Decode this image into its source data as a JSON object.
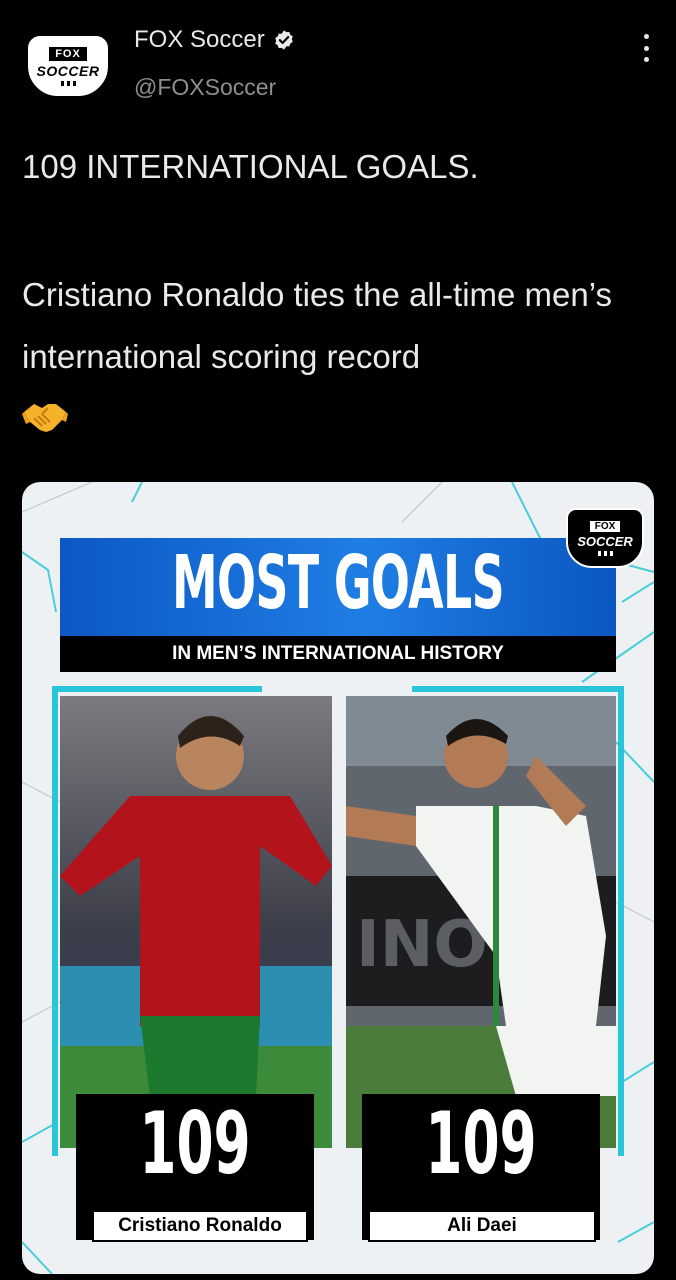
{
  "account": {
    "name": "FOX Soccer",
    "handle": "@FOXSoccer",
    "logo_top": "FOX",
    "logo_bottom": "SOCCER"
  },
  "tweet": {
    "line1": "109 INTERNATIONAL GOALS.",
    "line2": "Cristiano Ronaldo ties the all-time men’s international scoring record",
    "emoji": "handshake-emoji"
  },
  "graphic": {
    "title": "MOST GOALS",
    "subtitle": "IN MEN’S INTERNATIONAL HISTORY",
    "logo_top": "FOX",
    "logo_bottom": "SOCCER",
    "players": [
      {
        "name": "Cristiano Ronaldo",
        "goals": "109"
      },
      {
        "name": "Ali Daei",
        "goals": "109"
      }
    ]
  },
  "icons": {
    "verified": "verified-badge-icon",
    "more": "more-options-icon"
  },
  "colors": {
    "background": "#000000",
    "text": "#e7e9ea",
    "secondary_text": "#8b8f93",
    "graphic_blue": "#1f7ee4",
    "accent_cyan": "#28c6d8"
  }
}
